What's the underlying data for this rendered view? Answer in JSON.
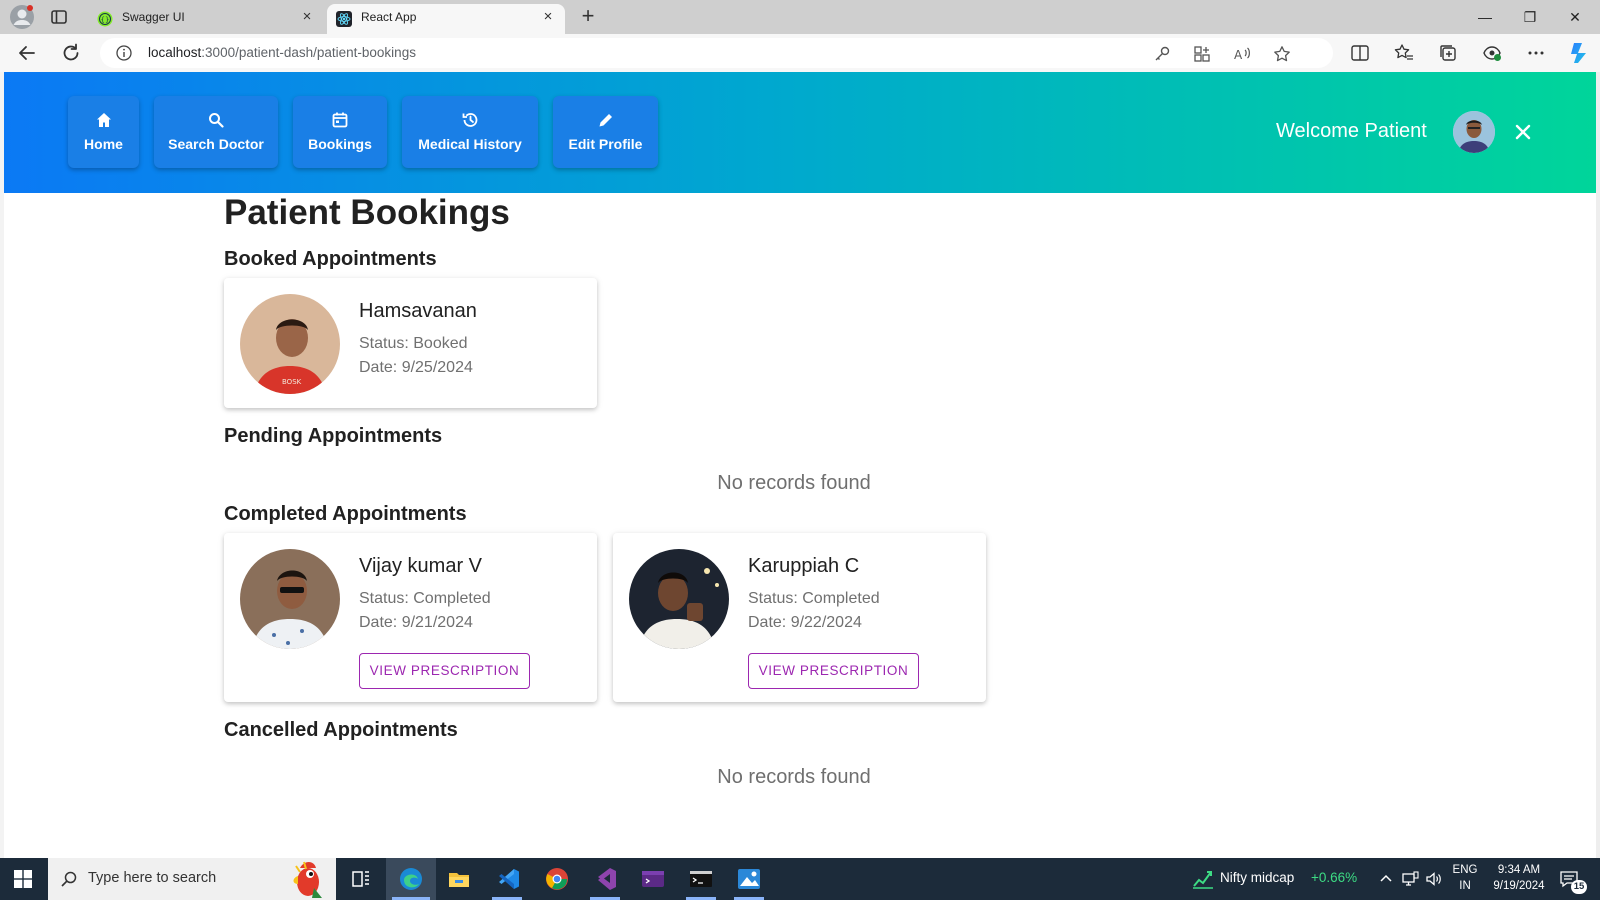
{
  "browser": {
    "tabs": [
      {
        "title": "Swagger UI"
      },
      {
        "title": "React App"
      }
    ],
    "url_host": "localhost",
    "url_path": ":3000/patient-dash/patient-bookings"
  },
  "nav": {
    "items": [
      {
        "label": "Home",
        "icon": "home-icon"
      },
      {
        "label": "Search Doctor",
        "icon": "search-icon"
      },
      {
        "label": "Bookings",
        "icon": "calendar-icon"
      },
      {
        "label": "Medical History",
        "icon": "history-icon"
      },
      {
        "label": "Edit Profile",
        "icon": "pencil-icon"
      }
    ],
    "welcome": "Welcome Patient"
  },
  "page": {
    "title": "Patient Bookings",
    "sections": {
      "booked": "Booked Appointments",
      "pending": "Pending Appointments",
      "completed": "Completed Appointments",
      "cancelled": "Cancelled Appointments"
    },
    "empty_message": "No records found",
    "booked": [
      {
        "doctor": "Hamsavanan",
        "status": "Status: Booked",
        "date": "Date: 9/25/2024"
      }
    ],
    "completed": [
      {
        "doctor": "Vijay kumar V",
        "status": "Status: Completed",
        "date": "Date: 9/21/2024",
        "action": "VIEW PRESCRIPTION"
      },
      {
        "doctor": "Karuppiah C",
        "status": "Status: Completed",
        "date": "Date: 9/22/2024",
        "action": "VIEW PRESCRIPTION"
      }
    ]
  },
  "taskbar": {
    "search_placeholder": "Type here to search",
    "ticker_name": "Nifty midcap",
    "ticker_change": "+0.66%",
    "lang_top": "ENG",
    "lang_bottom": "IN",
    "time": "9:34 AM",
    "date": "9/19/2024",
    "notifications": "15"
  },
  "colors": {
    "header_gradient_start": "#0b79f5",
    "header_gradient_end": "#00d59a",
    "nav_button": "#1a7fe6",
    "accent_purple": "#9c27b0",
    "ticker_green": "#3ddc84"
  }
}
